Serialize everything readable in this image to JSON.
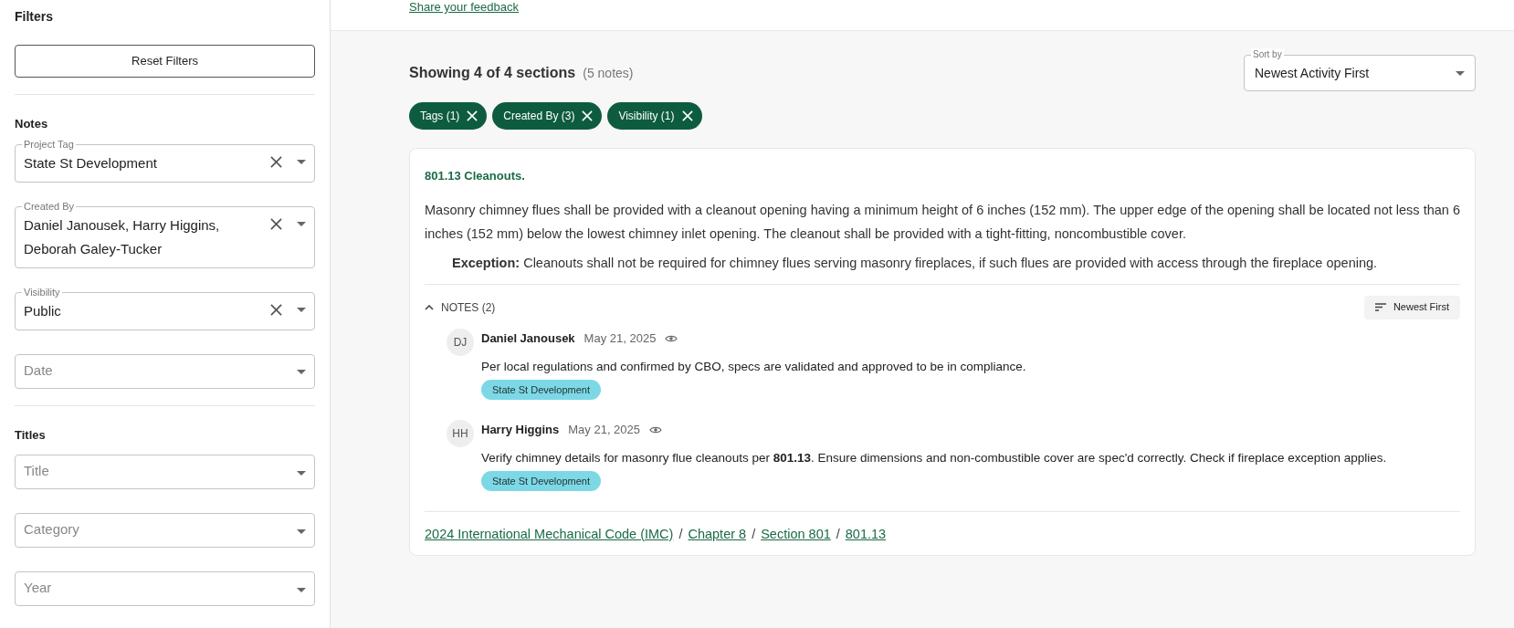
{
  "sidebar": {
    "title": "Filters",
    "reset_button": "Reset Filters",
    "groups": [
      {
        "title": "Notes",
        "fields": [
          {
            "label": "Project Tag",
            "value": "State St Development"
          },
          {
            "label": "Created By",
            "value": "Daniel Janousek, Harry Higgins, Deborah Galey-Tucker"
          },
          {
            "label": "Visibility",
            "value": "Public"
          },
          {
            "placeholder": "Date"
          }
        ]
      },
      {
        "title": "Titles",
        "fields": [
          {
            "placeholder": "Title"
          },
          {
            "placeholder": "Category"
          },
          {
            "placeholder": "Year"
          }
        ]
      }
    ]
  },
  "header": {
    "feedback_link": "Share your feedback"
  },
  "results": {
    "summary": "Showing 4 of 4 sections",
    "count": "(5 notes)",
    "sort": {
      "label": "Sort by",
      "value": "Newest Activity First"
    },
    "chips": [
      "Tags (1)",
      "Created By (3)",
      "Visibility (1)"
    ]
  },
  "section": {
    "title": "801.13 Cleanouts.",
    "body": "Masonry chimney flues shall be provided with a cleanout opening having a minimum height of 6 inches (152 mm). The upper edge of the opening shall be located not less than 6 inches (152 mm) below the lowest chimney inlet opening. The cleanout shall be provided with a tight-fitting, noncombustible cover.",
    "exception": "**Exception:** Cleanouts shall not be required for chimney flues serving masonry fireplaces, if such flues are provided with access through the fireplace opening.",
    "notes": {
      "header": "NOTES (2)",
      "expanded": true,
      "sort_button": "Newest First",
      "items": [
        {
          "initials": "DJ",
          "author": "Daniel Janousek",
          "date": "May 21, 2025",
          "text": "Per local regulations and confirmed by CBO, specs are validated and approved to be in compliance.",
          "tag": "State St Development"
        },
        {
          "initials": "HH",
          "author": "Harry Higgins",
          "date": "May 21, 2025",
          "text": "Verify chimney details for masonry flue cleanouts per **801.13**. Ensure dimensions and non-combustible cover are spec'd correctly. Check if fireplace exception applies.",
          "tag": "State St Development"
        }
      ]
    },
    "breadcrumb": [
      {
        "kind": "link",
        "label": "2024 International Mechanical Code (IMC)"
      },
      {
        "kind": "separator",
        "label": "/"
      },
      {
        "kind": "link",
        "label": "Chapter 8"
      },
      {
        "kind": "separator",
        "label": "/"
      },
      {
        "kind": "link",
        "label": "Section 801"
      },
      {
        "kind": "separator",
        "label": "/"
      },
      {
        "kind": "link",
        "label": "801.13"
      }
    ]
  }
}
